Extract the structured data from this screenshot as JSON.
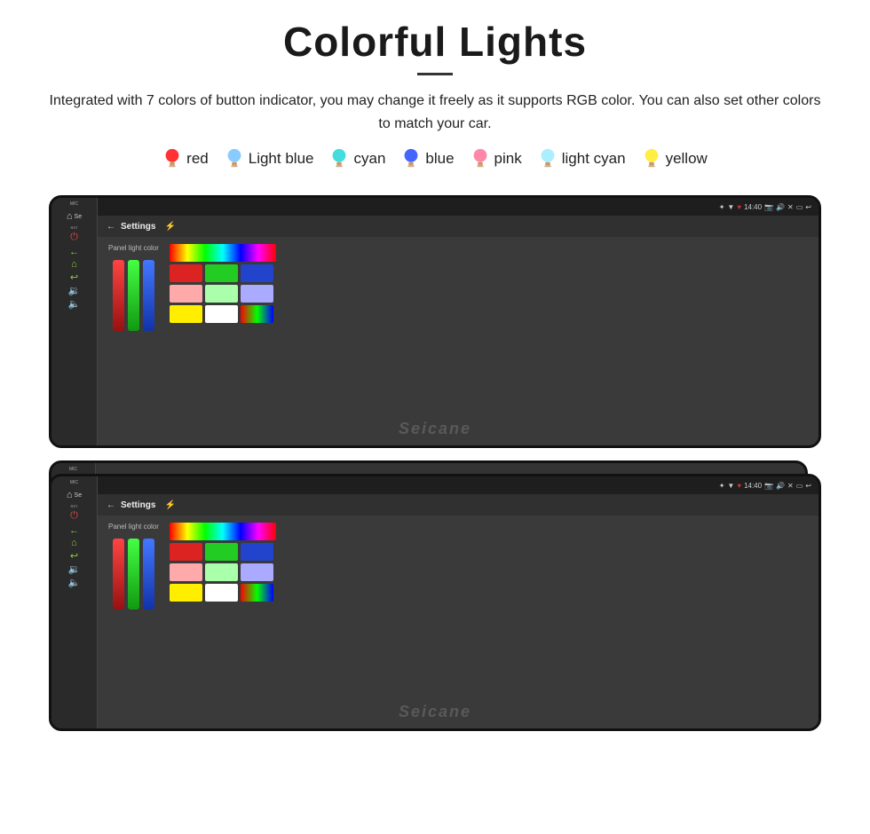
{
  "title": "Colorful Lights",
  "description": "Integrated with 7 colors of button indicator, you may change it freely as it supports RGB color. You can also set other colors to match your car.",
  "colors": [
    {
      "label": "red",
      "color": "#ff3333",
      "bulb_color": "#ff4444"
    },
    {
      "label": "Light blue",
      "color": "#88ccff",
      "bulb_color": "#88ccff"
    },
    {
      "label": "cyan",
      "color": "#44dddd",
      "bulb_color": "#44dddd"
    },
    {
      "label": "blue",
      "color": "#4466ff",
      "bulb_color": "#4466ff"
    },
    {
      "label": "pink",
      "color": "#ff88aa",
      "bulb_color": "#ff88aa"
    },
    {
      "label": "light cyan",
      "color": "#aaeeff",
      "bulb_color": "#aaeeff"
    },
    {
      "label": "yellow",
      "color": "#ffee44",
      "bulb_color": "#ffee44"
    }
  ],
  "screen": {
    "settings_label": "Settings",
    "panel_light_color": "Panel light color",
    "time": "14:40",
    "watermark": "Seicane"
  },
  "color_grid": {
    "rainbow": true,
    "cells": [
      "#dd2222",
      "#22cc22",
      "#2244dd",
      "#ffaaaa",
      "#aaffaa",
      "#aaaaff",
      "#ffee00",
      "#ffffff",
      "rainbow"
    ]
  }
}
